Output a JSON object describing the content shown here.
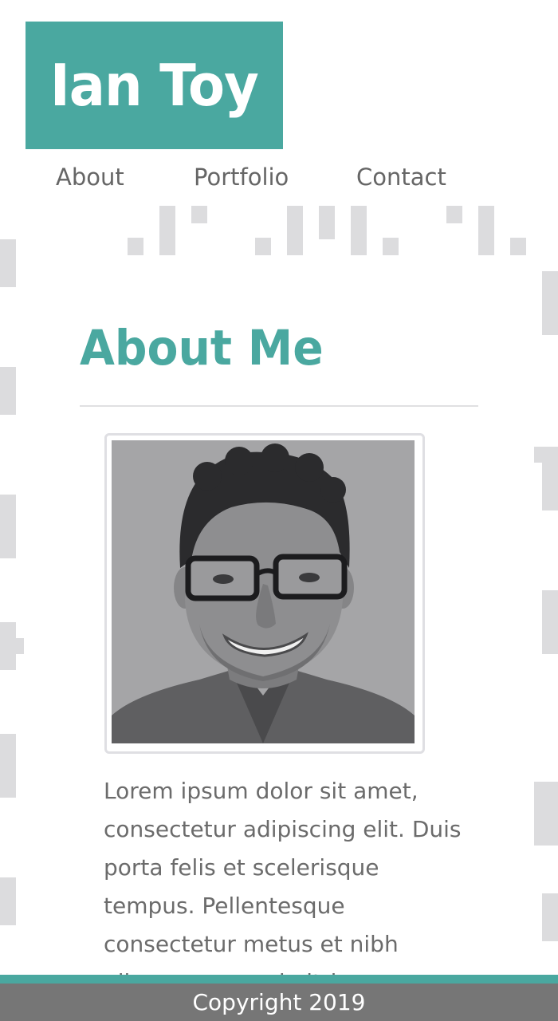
{
  "header": {
    "site_title": "Ian Toy",
    "nav": [
      "About",
      "Portfolio",
      "Contact"
    ]
  },
  "main": {
    "heading": "About Me",
    "photo": "portrait photo",
    "body_text": "Lorem ipsum dolor sit amet, consectetur adipiscing elit. Duis porta felis et scelerisque tempus. Pellentesque consectetur metus et nibh ullamcorper, vel ultrices"
  },
  "footer": {
    "copyright": "Copyright 2019"
  },
  "colors": {
    "accent": "#4aa8a0",
    "nav_text": "#666666",
    "body_text": "#6b6b6b",
    "footer_bg": "#767676",
    "pattern": "#dcdcde"
  }
}
